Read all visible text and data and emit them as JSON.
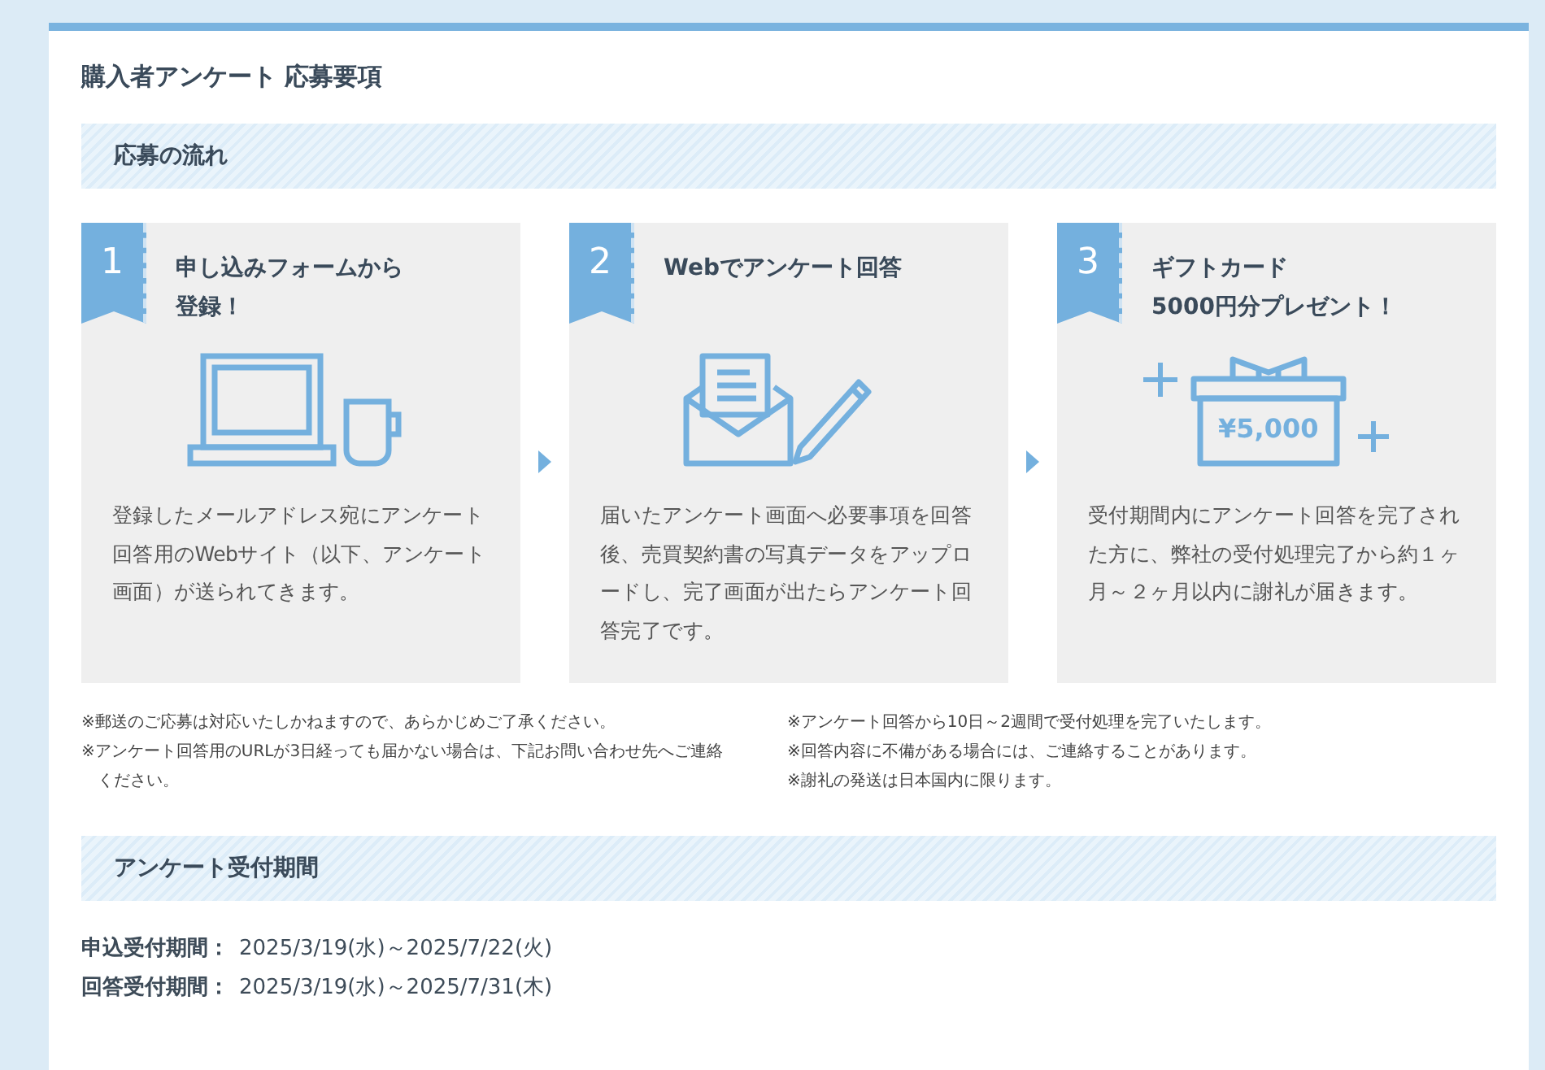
{
  "page_title": "購入者アンケート 応募要項",
  "flow_section": {
    "heading": "応募の流れ",
    "steps": [
      {
        "number": "1",
        "title_lines": [
          "申し込みフォームから",
          "登録！"
        ],
        "illustration": {
          "kind": "laptop"
        },
        "description": "登録したメールアドレス宛にアンケート回答用のWebサイト（以下、アンケート画面）が送られてきます。"
      },
      {
        "number": "2",
        "title_lines": [
          "Webでアンケート回答"
        ],
        "illustration": {
          "kind": "mail"
        },
        "description": "届いたアンケート画面へ必要事項を回答後、売買契約書の写真データをアップロードし、完了画面が出たらアンケート回答完了です。"
      },
      {
        "number": "3",
        "title_lines": [
          "ギフトカード",
          "5000円分プレゼント！"
        ],
        "illustration": {
          "kind": "gift",
          "amount": "¥5,000"
        },
        "description": "受付期間内にアンケート回答を完了された方に、弊社の受付処理完了から約１ヶ月～２ヶ月以内に謝礼が届きます。"
      }
    ],
    "notes_left": [
      "※郵送のご応募は対応いたしかねますので、あらかじめご了承ください。",
      "※アンケート回答用のURLが3日経っても届かない場合は、下記お問い合わせ先へご連絡ください。"
    ],
    "notes_right": [
      "※アンケート回答から10日～2週間で受付処理を完了いたします。",
      "※回答内容に不備がある場合には、ご連絡することがあります。",
      "※謝礼の発送は日本国内に限ります。"
    ]
  },
  "period_section": {
    "heading": "アンケート受付期間",
    "periods": [
      {
        "label": "申込受付期間：",
        "value": "2025/3/19(水)～2025/7/22(火)"
      },
      {
        "label": "回答受付期間：",
        "value": "2025/3/19(水)～2025/7/31(木)"
      }
    ]
  }
}
